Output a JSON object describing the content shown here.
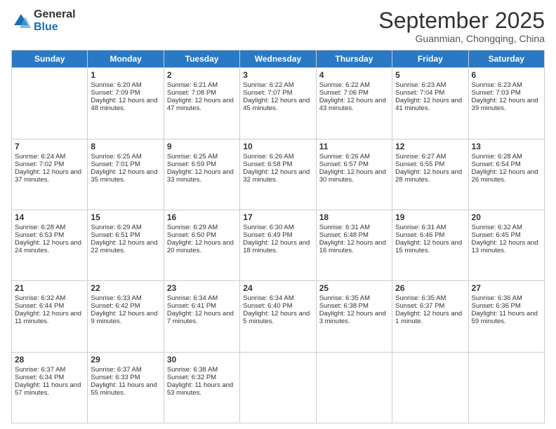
{
  "logo": {
    "general": "General",
    "blue": "Blue"
  },
  "title": "September 2025",
  "subtitle": "Guanmian, Chongqing, China",
  "days": [
    "Sunday",
    "Monday",
    "Tuesday",
    "Wednesday",
    "Thursday",
    "Friday",
    "Saturday"
  ],
  "weeks": [
    [
      {
        "day": "",
        "sunrise": "",
        "sunset": "",
        "daylight": ""
      },
      {
        "day": "1",
        "sunrise": "Sunrise: 6:20 AM",
        "sunset": "Sunset: 7:09 PM",
        "daylight": "Daylight: 12 hours and 48 minutes."
      },
      {
        "day": "2",
        "sunrise": "Sunrise: 6:21 AM",
        "sunset": "Sunset: 7:08 PM",
        "daylight": "Daylight: 12 hours and 47 minutes."
      },
      {
        "day": "3",
        "sunrise": "Sunrise: 6:22 AM",
        "sunset": "Sunset: 7:07 PM",
        "daylight": "Daylight: 12 hours and 45 minutes."
      },
      {
        "day": "4",
        "sunrise": "Sunrise: 6:22 AM",
        "sunset": "Sunset: 7:06 PM",
        "daylight": "Daylight: 12 hours and 43 minutes."
      },
      {
        "day": "5",
        "sunrise": "Sunrise: 6:23 AM",
        "sunset": "Sunset: 7:04 PM",
        "daylight": "Daylight: 12 hours and 41 minutes."
      },
      {
        "day": "6",
        "sunrise": "Sunrise: 6:23 AM",
        "sunset": "Sunset: 7:03 PM",
        "daylight": "Daylight: 12 hours and 39 minutes."
      }
    ],
    [
      {
        "day": "7",
        "sunrise": "Sunrise: 6:24 AM",
        "sunset": "Sunset: 7:02 PM",
        "daylight": "Daylight: 12 hours and 37 minutes."
      },
      {
        "day": "8",
        "sunrise": "Sunrise: 6:25 AM",
        "sunset": "Sunset: 7:01 PM",
        "daylight": "Daylight: 12 hours and 35 minutes."
      },
      {
        "day": "9",
        "sunrise": "Sunrise: 6:25 AM",
        "sunset": "Sunset: 6:59 PM",
        "daylight": "Daylight: 12 hours and 33 minutes."
      },
      {
        "day": "10",
        "sunrise": "Sunrise: 6:26 AM",
        "sunset": "Sunset: 6:58 PM",
        "daylight": "Daylight: 12 hours and 32 minutes."
      },
      {
        "day": "11",
        "sunrise": "Sunrise: 6:26 AM",
        "sunset": "Sunset: 6:57 PM",
        "daylight": "Daylight: 12 hours and 30 minutes."
      },
      {
        "day": "12",
        "sunrise": "Sunrise: 6:27 AM",
        "sunset": "Sunset: 6:55 PM",
        "daylight": "Daylight: 12 hours and 28 minutes."
      },
      {
        "day": "13",
        "sunrise": "Sunrise: 6:28 AM",
        "sunset": "Sunset: 6:54 PM",
        "daylight": "Daylight: 12 hours and 26 minutes."
      }
    ],
    [
      {
        "day": "14",
        "sunrise": "Sunrise: 6:28 AM",
        "sunset": "Sunset: 6:53 PM",
        "daylight": "Daylight: 12 hours and 24 minutes."
      },
      {
        "day": "15",
        "sunrise": "Sunrise: 6:29 AM",
        "sunset": "Sunset: 6:51 PM",
        "daylight": "Daylight: 12 hours and 22 minutes."
      },
      {
        "day": "16",
        "sunrise": "Sunrise: 6:29 AM",
        "sunset": "Sunset: 6:50 PM",
        "daylight": "Daylight: 12 hours and 20 minutes."
      },
      {
        "day": "17",
        "sunrise": "Sunrise: 6:30 AM",
        "sunset": "Sunset: 6:49 PM",
        "daylight": "Daylight: 12 hours and 18 minutes."
      },
      {
        "day": "18",
        "sunrise": "Sunrise: 6:31 AM",
        "sunset": "Sunset: 6:48 PM",
        "daylight": "Daylight: 12 hours and 16 minutes."
      },
      {
        "day": "19",
        "sunrise": "Sunrise: 6:31 AM",
        "sunset": "Sunset: 6:46 PM",
        "daylight": "Daylight: 12 hours and 15 minutes."
      },
      {
        "day": "20",
        "sunrise": "Sunrise: 6:32 AM",
        "sunset": "Sunset: 6:45 PM",
        "daylight": "Daylight: 12 hours and 13 minutes."
      }
    ],
    [
      {
        "day": "21",
        "sunrise": "Sunrise: 6:32 AM",
        "sunset": "Sunset: 6:44 PM",
        "daylight": "Daylight: 12 hours and 11 minutes."
      },
      {
        "day": "22",
        "sunrise": "Sunrise: 6:33 AM",
        "sunset": "Sunset: 6:42 PM",
        "daylight": "Daylight: 12 hours and 9 minutes."
      },
      {
        "day": "23",
        "sunrise": "Sunrise: 6:34 AM",
        "sunset": "Sunset: 6:41 PM",
        "daylight": "Daylight: 12 hours and 7 minutes."
      },
      {
        "day": "24",
        "sunrise": "Sunrise: 6:34 AM",
        "sunset": "Sunset: 6:40 PM",
        "daylight": "Daylight: 12 hours and 5 minutes."
      },
      {
        "day": "25",
        "sunrise": "Sunrise: 6:35 AM",
        "sunset": "Sunset: 6:38 PM",
        "daylight": "Daylight: 12 hours and 3 minutes."
      },
      {
        "day": "26",
        "sunrise": "Sunrise: 6:35 AM",
        "sunset": "Sunset: 6:37 PM",
        "daylight": "Daylight: 12 hours and 1 minute."
      },
      {
        "day": "27",
        "sunrise": "Sunrise: 6:36 AM",
        "sunset": "Sunset: 6:36 PM",
        "daylight": "Daylight: 11 hours and 59 minutes."
      }
    ],
    [
      {
        "day": "28",
        "sunrise": "Sunrise: 6:37 AM",
        "sunset": "Sunset: 6:34 PM",
        "daylight": "Daylight: 11 hours and 57 minutes."
      },
      {
        "day": "29",
        "sunrise": "Sunrise: 6:37 AM",
        "sunset": "Sunset: 6:33 PM",
        "daylight": "Daylight: 11 hours and 55 minutes."
      },
      {
        "day": "30",
        "sunrise": "Sunrise: 6:38 AM",
        "sunset": "Sunset: 6:32 PM",
        "daylight": "Daylight: 11 hours and 53 minutes."
      },
      {
        "day": "",
        "sunrise": "",
        "sunset": "",
        "daylight": ""
      },
      {
        "day": "",
        "sunrise": "",
        "sunset": "",
        "daylight": ""
      },
      {
        "day": "",
        "sunrise": "",
        "sunset": "",
        "daylight": ""
      },
      {
        "day": "",
        "sunrise": "",
        "sunset": "",
        "daylight": ""
      }
    ]
  ]
}
